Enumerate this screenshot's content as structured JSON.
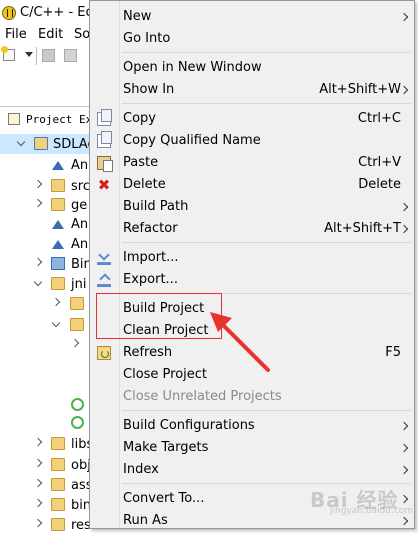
{
  "window": {
    "title": "C/C++ - Ecl"
  },
  "menubar": {
    "file": "File",
    "edit": "Edit",
    "source": "So"
  },
  "explorer": {
    "tab_label": "Project Ex",
    "rows": [
      {
        "label": "SDLAc"
      },
      {
        "label": "An"
      },
      {
        "label": "src"
      },
      {
        "label": "ge"
      },
      {
        "label": "An"
      },
      {
        "label": "An"
      },
      {
        "label": "Bin"
      },
      {
        "label": "jni"
      },
      {
        "label": ""
      },
      {
        "label": ""
      },
      {
        "label": ""
      },
      {
        "label": "libs"
      },
      {
        "label": "obj"
      },
      {
        "label": "ass"
      },
      {
        "label": "bin"
      },
      {
        "label": "res"
      }
    ]
  },
  "context_menu": {
    "items": [
      {
        "label": "New",
        "submenu": true
      },
      {
        "label": "Go Into"
      },
      {
        "label": "Open in New Window"
      },
      {
        "label": "Show In",
        "shortcut": "Alt+Shift+W",
        "submenu": true
      },
      {
        "label": "Copy",
        "shortcut": "Ctrl+C",
        "icon": "copy-icon"
      },
      {
        "label": "Copy Qualified Name",
        "icon": "copy-icon"
      },
      {
        "label": "Paste",
        "shortcut": "Ctrl+V",
        "icon": "paste-icon"
      },
      {
        "label": "Delete",
        "shortcut": "Delete",
        "icon": "delete-icon"
      },
      {
        "label": "Build Path",
        "submenu": true
      },
      {
        "label": "Refactor",
        "shortcut": "Alt+Shift+T",
        "submenu": true
      },
      {
        "label": "Import...",
        "icon": "import-icon"
      },
      {
        "label": "Export...",
        "icon": "export-icon"
      },
      {
        "label": "Build Project"
      },
      {
        "label": "Clean Project"
      },
      {
        "label": "Refresh",
        "shortcut": "F5",
        "icon": "refresh-icon"
      },
      {
        "label": "Close Project"
      },
      {
        "label": "Close Unrelated Projects",
        "disabled": true
      },
      {
        "label": "Build Configurations",
        "submenu": true
      },
      {
        "label": "Make Targets",
        "submenu": true
      },
      {
        "label": "Index",
        "submenu": true
      },
      {
        "label": "Convert To...",
        "submenu": true
      },
      {
        "label": "Run As",
        "submenu": true
      }
    ]
  },
  "watermark": {
    "text": "Bai 经验",
    "sub": "jingyan.baidu.com"
  },
  "colors": {
    "highlight": "#e8322f",
    "menu_bg": "#f0f0f0",
    "selection": "#cce8ff"
  }
}
